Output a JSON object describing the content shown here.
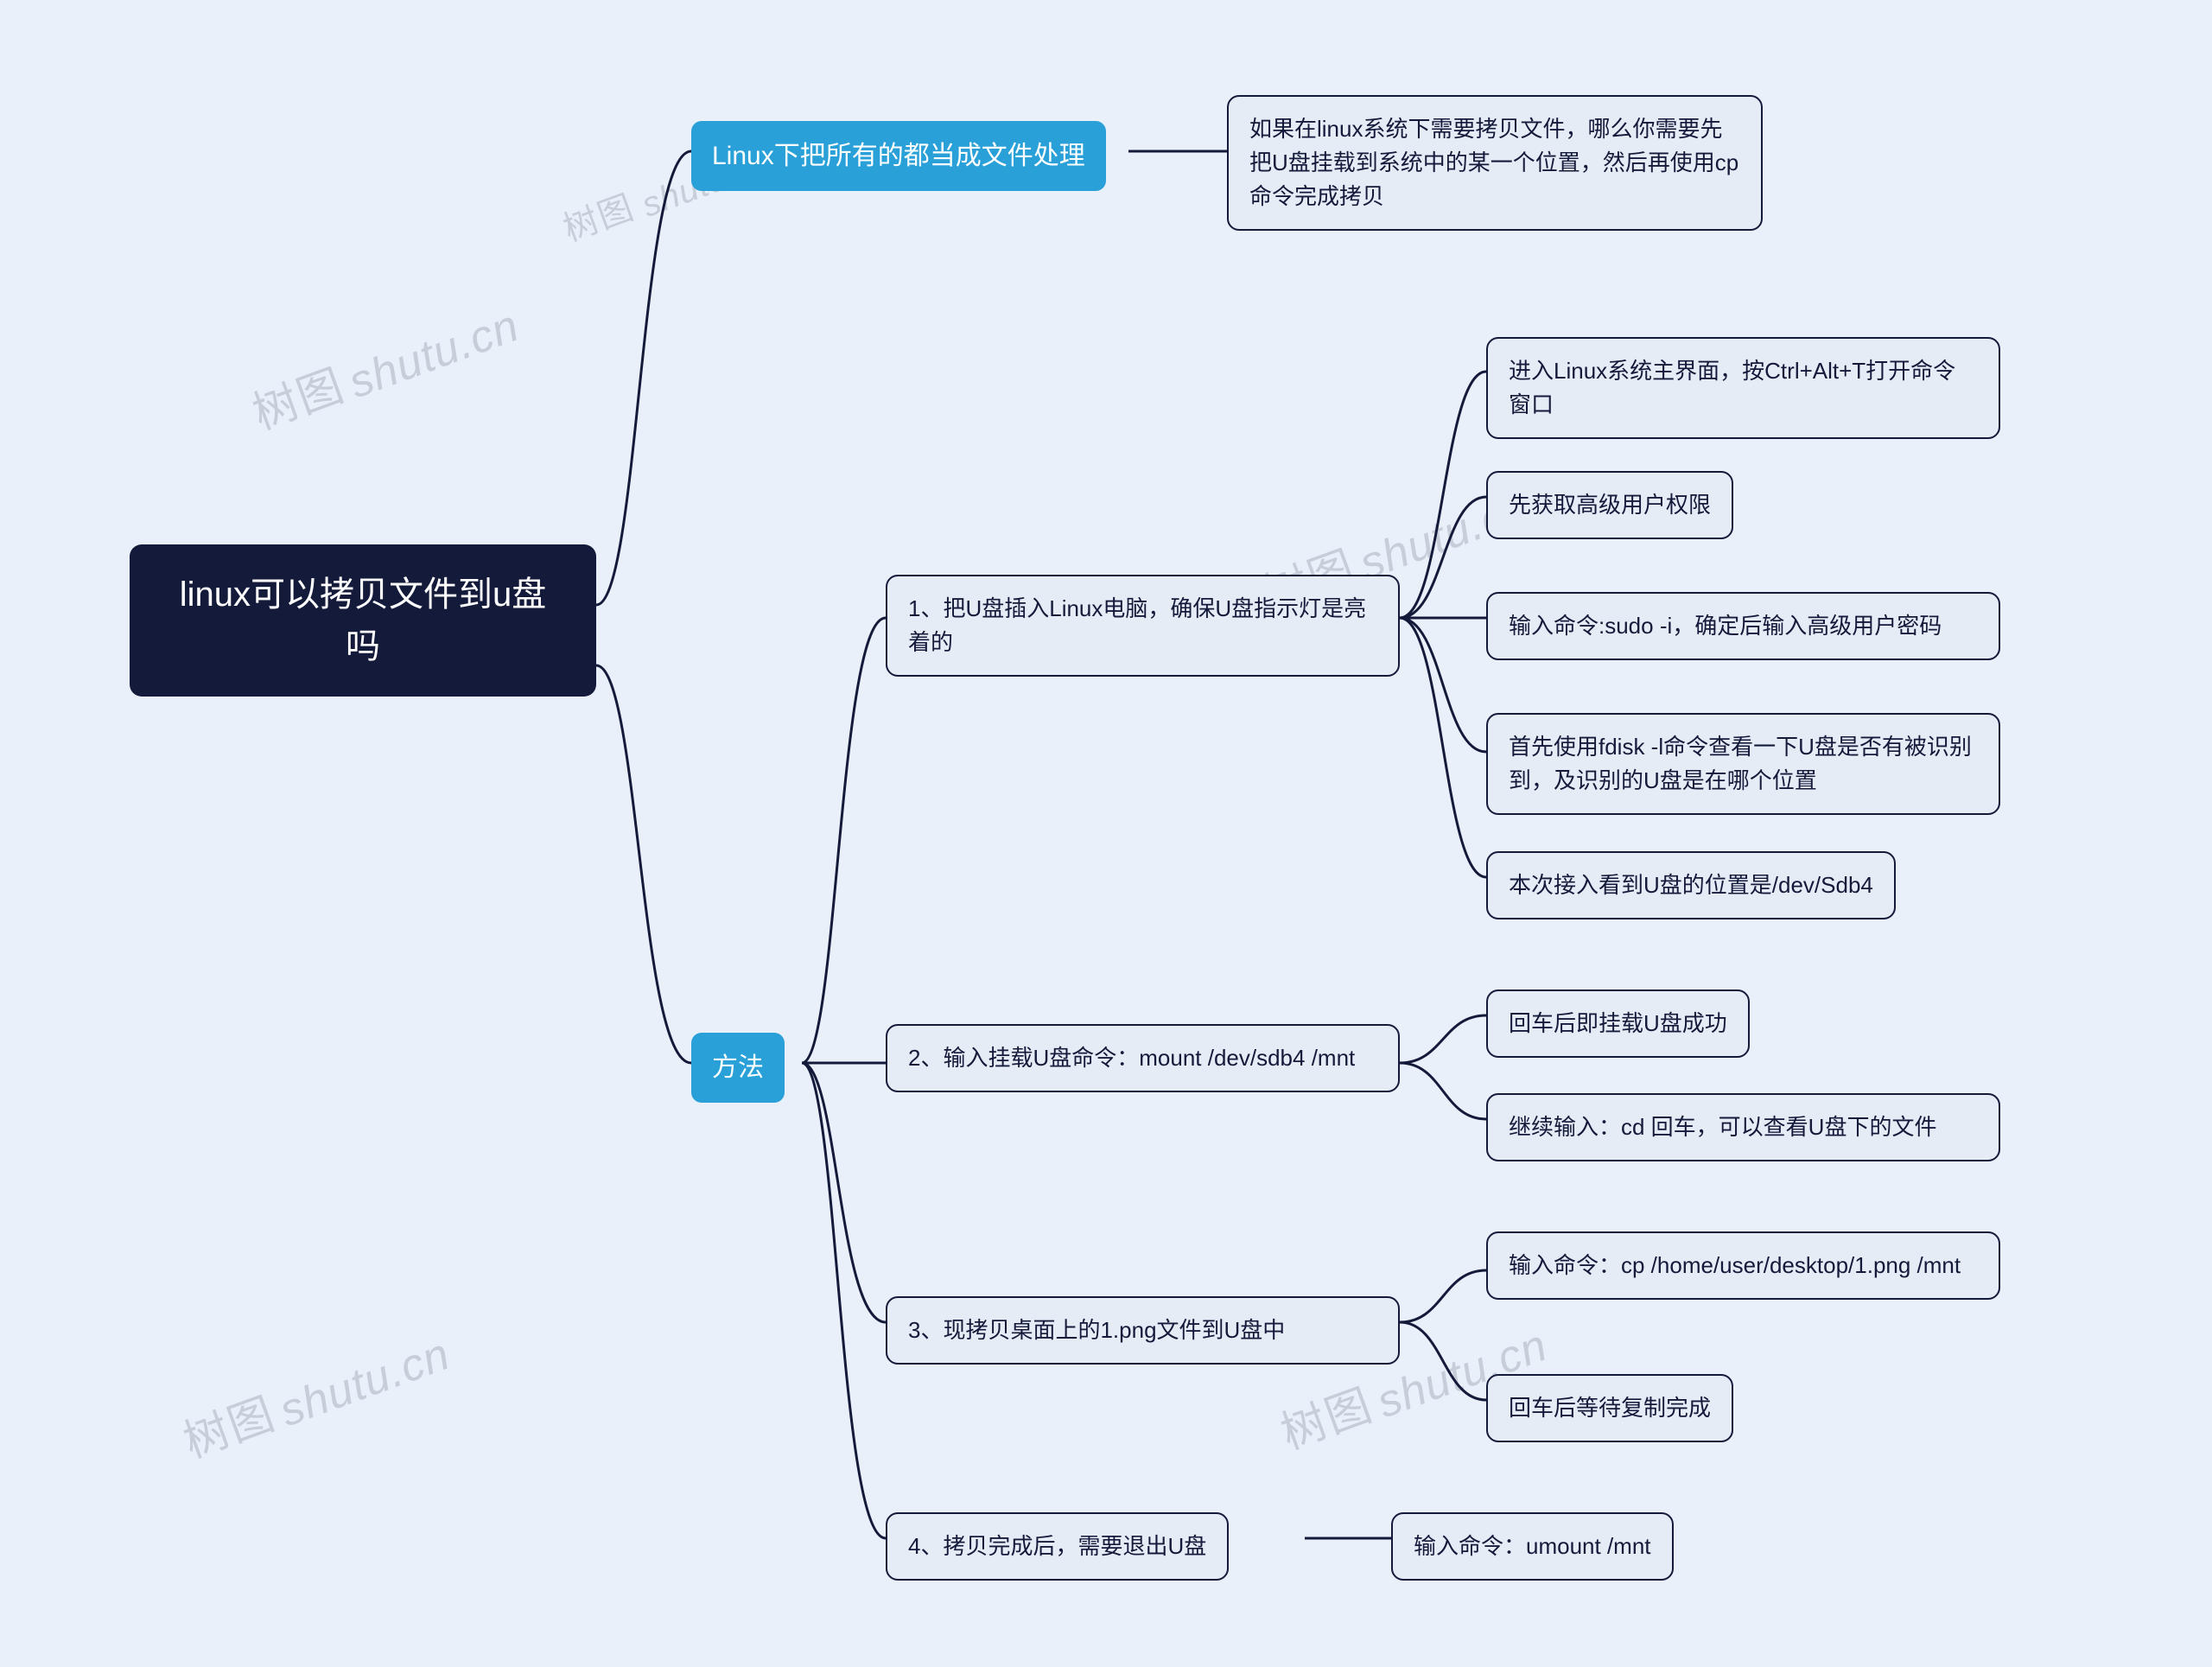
{
  "root": {
    "line1": "linux可以拷贝文件到u盘",
    "line2": "吗"
  },
  "branch1": {
    "title": "Linux下把所有的都当成文件处理",
    "desc": "如果在linux系统下需要拷贝文件，哪么你需要先把U盘挂载到系统中的某一个位置，然后再使用cp命令完成拷贝"
  },
  "branch2": {
    "title": "方法",
    "steps": [
      {
        "label": "1、把U盘插入Linux电脑，确保U盘指示灯是亮着的",
        "children": [
          "进入Linux系统主界面，按Ctrl+Alt+T打开命令窗口",
          "先获取高级用户权限",
          "输入命令:sudo -i，确定后输入高级用户密码",
          "首先使用fdisk -l命令查看一下U盘是否有被识别到，及识别的U盘是在哪个位置",
          "本次接入看到U盘的位置是/dev/Sdb4"
        ]
      },
      {
        "label": "2、输入挂载U盘命令：mount /dev/sdb4 /mnt",
        "children": [
          "回车后即挂载U盘成功",
          "继续输入：cd 回车，可以查看U盘下的文件"
        ]
      },
      {
        "label": "3、现拷贝桌面上的1.png文件到U盘中",
        "children": [
          "输入命令：cp /home/user/desktop/1.png /mnt",
          "回车后等待复制完成"
        ]
      },
      {
        "label": "4、拷贝完成后，需要退出U盘",
        "children": [
          "输入命令：umount /mnt"
        ]
      }
    ]
  },
  "watermarks": [
    {
      "cn": "树图",
      "en": "shutu.cn"
    }
  ]
}
